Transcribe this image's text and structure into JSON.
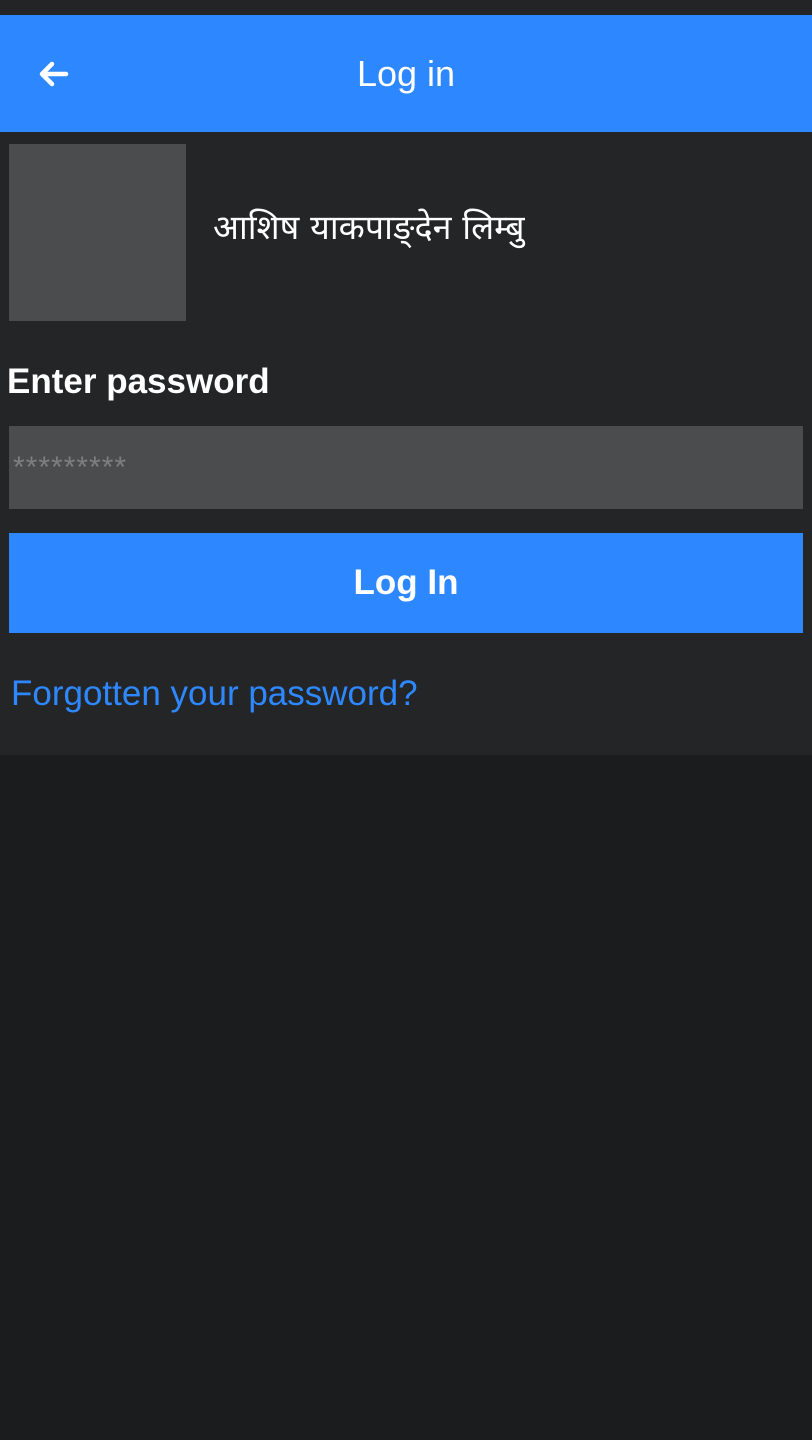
{
  "app_bar": {
    "title": "Log in",
    "back_icon": "arrow-left-icon",
    "color": "#2d88ff"
  },
  "account": {
    "name": "आशिष याकपाङ्देन लिम्बु"
  },
  "form": {
    "password_label": "Enter password",
    "password_placeholder": "*********",
    "login_button_label": "Log In",
    "forgot_link": "Forgotten your password?"
  },
  "colors": {
    "accent": "#2d88ff",
    "background": "#1b1c1e",
    "panel": "#242527",
    "field": "#4b4c4e"
  }
}
